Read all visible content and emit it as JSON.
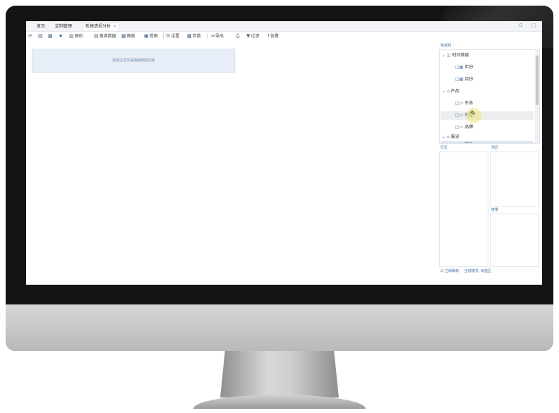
{
  "tabs": [
    {
      "label": "首页"
    },
    {
      "label": "定制管理"
    },
    {
      "label": "新建透视分析",
      "close": "×"
    }
  ],
  "window_controls": {
    "search": "Q",
    "restore": "□"
  },
  "toolbar": {
    "items": [
      {
        "icon": "refresh-icon",
        "glyph": "⟳",
        "label": ""
      },
      {
        "icon": "save-icon",
        "glyph": "▤",
        "label": ""
      },
      {
        "icon": "save-as-icon",
        "glyph": "▦",
        "label": ""
      },
      {
        "icon": "star-icon",
        "glyph": "★",
        "label": ""
      },
      {
        "icon": "chart-icon",
        "glyph": "▥",
        "label": "图形"
      },
      {
        "icon": "dataset-icon",
        "glyph": "▤",
        "label": "更换数据"
      },
      {
        "icon": "panel-icon",
        "glyph": "▦",
        "label": "面板"
      },
      {
        "icon": "view-icon",
        "glyph": "▣",
        "label": "视图"
      },
      {
        "icon": "settings-icon",
        "glyph": "⚙",
        "label": "设置"
      },
      {
        "icon": "params-icon",
        "glyph": "▩",
        "label": "参数"
      },
      {
        "icon": "export-icon",
        "glyph": "⇥",
        "label": "导出"
      },
      {
        "icon": "print-icon",
        "glyph": "⎙",
        "label": ""
      },
      {
        "icon": "filter-icon",
        "glyph": "▼",
        "label": "过滤"
      },
      {
        "icon": "alert-icon",
        "glyph": "!",
        "label": "告警"
      }
    ]
  },
  "canvas": {
    "drop_hint": "请将过滤字段拖曳到此区域"
  },
  "right_panel": {
    "title": "待选列",
    "tree": [
      {
        "label": "时间维度",
        "icon": "◫",
        "expander": "⌄",
        "indent": 0
      },
      {
        "label": "年份",
        "icon": "□▦",
        "indent": 1
      },
      {
        "label": "月份",
        "icon": "□▦",
        "indent": 1
      },
      {
        "label": "产品",
        "icon": "⌂",
        "expander": "⌄",
        "indent": 0
      },
      {
        "label": "车系",
        "icon": "□▭",
        "indent": 1
      },
      {
        "label": "车型",
        "icon": "□▭",
        "indent": 1
      },
      {
        "label": "品牌",
        "icon": "□▭",
        "indent": 1
      },
      {
        "label": "需求",
        "icon": "⌂",
        "expander": "⌄",
        "indent": 0
      },
      {
        "label": "车系",
        "icon": "□▭",
        "indent": 1
      }
    ],
    "row_area_label": "行区",
    "col_area_label": "列区",
    "measure_area_label": "度量",
    "refresh_checkbox": "☑",
    "refresh_label": "立即刷新",
    "mode_label": "当前模式: 待选区"
  }
}
